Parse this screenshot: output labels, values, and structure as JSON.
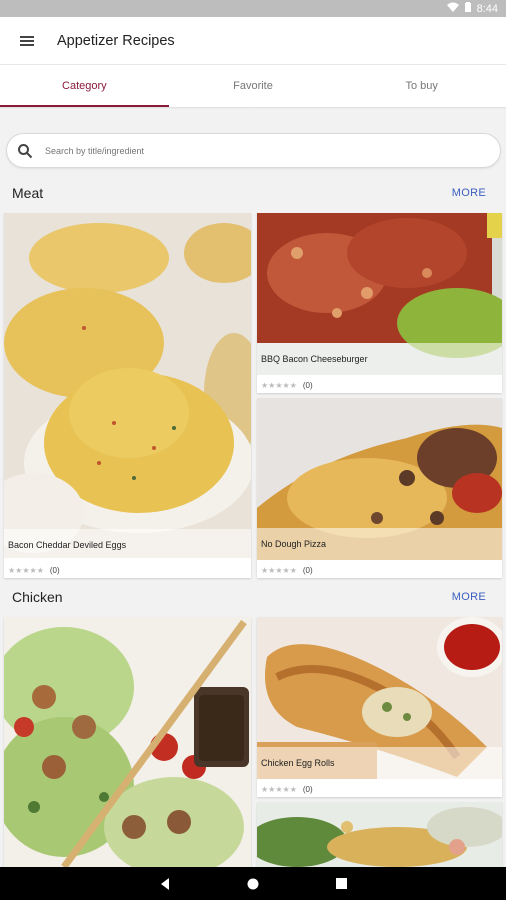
{
  "status": {
    "time": "8:44"
  },
  "appbar": {
    "title": "Appetizer Recipes"
  },
  "tabs": [
    {
      "label": "Category",
      "active": true
    },
    {
      "label": "Favorite",
      "active": false
    },
    {
      "label": "To buy",
      "active": false
    }
  ],
  "search": {
    "placeholder": "Search by title/ingredient"
  },
  "sections": [
    {
      "title": "Meat",
      "more": "MORE",
      "recipes": [
        {
          "name": "Bacon Cheddar Deviled Eggs",
          "rating_count": "(0)"
        },
        {
          "name": "BBQ Bacon Cheeseburger",
          "rating_count": "(0)"
        },
        {
          "name": "No Dough Pizza",
          "rating_count": "(0)"
        }
      ]
    },
    {
      "title": "Chicken",
      "more": "MORE",
      "recipes": [
        {
          "name": "",
          "rating_count": ""
        },
        {
          "name": "Chicken Egg Rolls",
          "rating_count": "(0)"
        },
        {
          "name": "",
          "rating_count": ""
        }
      ]
    }
  ],
  "colors": {
    "accent": "#8a1a3a",
    "more_link": "#3b5fc0"
  }
}
